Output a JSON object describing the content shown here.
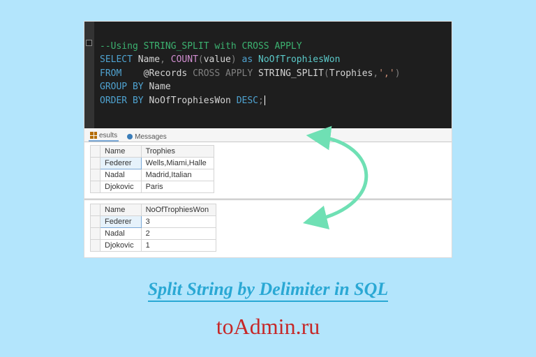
{
  "sql": {
    "comment": "--Using STRING_SPLIT with CROSS APPLY",
    "line2": {
      "select": "SELECT",
      "name": "Name",
      "comma1": ",",
      "count": "COUNT",
      "lp": "(",
      "value": "value",
      "rp": ")",
      "as": "as",
      "alias": "NoOfTrophiesWon"
    },
    "line3": {
      "from": "FROM",
      "tab": "   ",
      "tbl": "@Records",
      "cross": "CROSS",
      "apply": "APPLY",
      "fn": "STRING_SPLIT",
      "lp": "(",
      "arg1": "Trophies",
      "comma": ",",
      "q": "'",
      "delim": ",",
      "q2": "'",
      "rp": ")"
    },
    "line4": {
      "group": "GROUP",
      "by": "BY",
      "col": "Name"
    },
    "line5": {
      "order": "ORDER",
      "by": "BY",
      "col": "NoOfTrophiesWon",
      "desc": "DESC",
      "semi": ";"
    }
  },
  "tabs": {
    "results": "esults",
    "messages": "Messages"
  },
  "table1": {
    "headers": [
      "Name",
      "Trophies"
    ],
    "rows": [
      {
        "name": "Federer",
        "val": "Wells,Miami,Halle",
        "selected": true
      },
      {
        "name": "Nadal",
        "val": "Madrid,Italian",
        "selected": false
      },
      {
        "name": "Djokovic",
        "val": "Paris",
        "selected": false
      }
    ]
  },
  "table2": {
    "headers": [
      "Name",
      "NoOfTrophiesWon"
    ],
    "rows": [
      {
        "name": "Federer",
        "val": "3",
        "selected": true
      },
      {
        "name": "Nadal",
        "val": "2",
        "selected": false
      },
      {
        "name": "Djokovic",
        "val": "1",
        "selected": false
      }
    ]
  },
  "caption": "Split String by Delimiter in SQL",
  "watermark": "toAdmin.ru"
}
